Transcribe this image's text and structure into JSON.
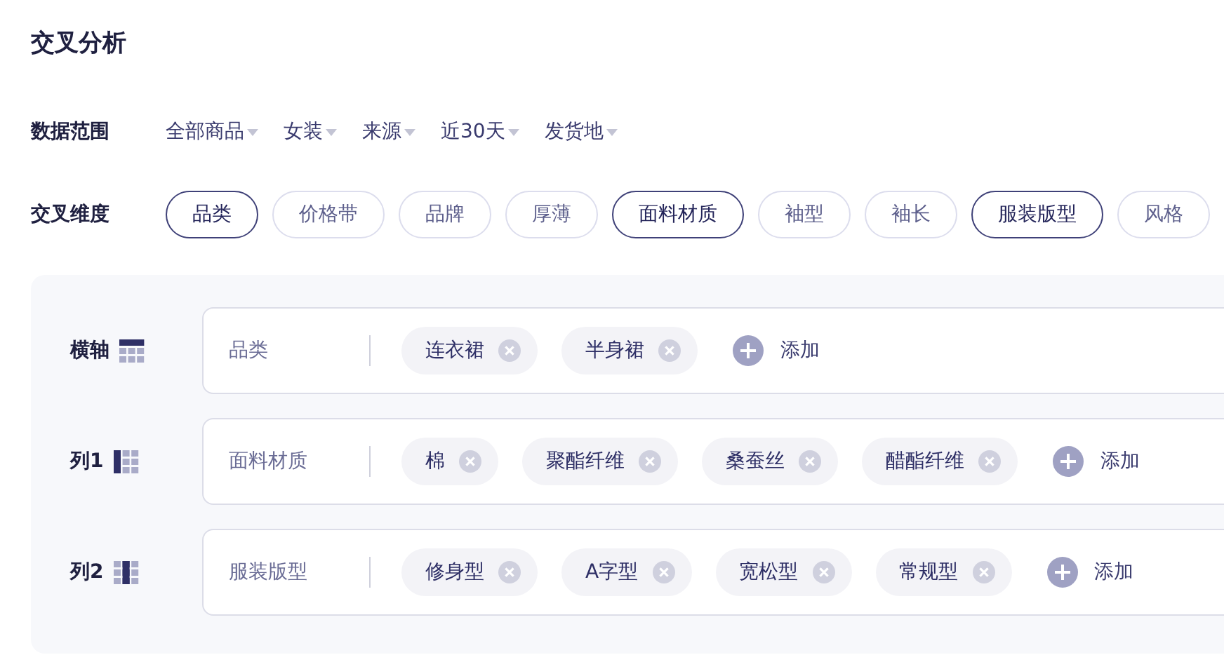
{
  "title": "交叉分析",
  "data_range": {
    "label": "数据范围",
    "filters": [
      "全部商品",
      "女装",
      "来源",
      "近30天",
      "发货地"
    ]
  },
  "dimensions": {
    "label": "交叉维度",
    "chips": [
      {
        "label": "品类",
        "selected": true
      },
      {
        "label": "价格带",
        "selected": false
      },
      {
        "label": "品牌",
        "selected": false
      },
      {
        "label": "厚薄",
        "selected": false
      },
      {
        "label": "面料材质",
        "selected": true
      },
      {
        "label": "袖型",
        "selected": false
      },
      {
        "label": "袖长",
        "selected": false
      },
      {
        "label": "服装版型",
        "selected": true
      },
      {
        "label": "风格",
        "selected": false
      }
    ]
  },
  "axes": [
    {
      "label": "横轴",
      "kind": "header_row",
      "dimension": "品类",
      "values": [
        "连衣裙",
        "半身裙"
      ],
      "add": "添加"
    },
    {
      "label": "列1",
      "kind": "first_column",
      "dimension": "面料材质",
      "values": [
        "棉",
        "聚酯纤维",
        "桑蚕丝",
        "醋酯纤维"
      ],
      "add": "添加"
    },
    {
      "label": "列2",
      "kind": "second_column",
      "dimension": "服装版型",
      "values": [
        "修身型",
        "A字型",
        "宽松型",
        "常规型"
      ],
      "add": "添加"
    }
  ]
}
